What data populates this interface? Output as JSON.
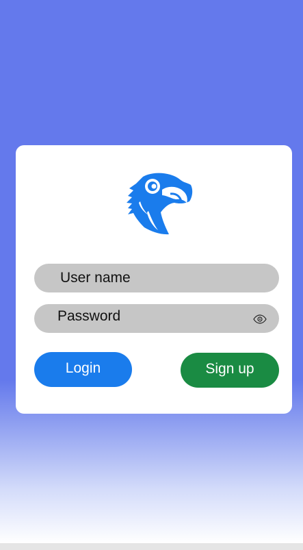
{
  "login_form": {
    "username_placeholder": "User name",
    "password_placeholder": "Password",
    "login_label": "Login",
    "signup_label": "Sign up"
  },
  "icons": {
    "logo": "eagle-head-icon",
    "password_toggle": "eye-icon"
  },
  "colors": {
    "background": "#6479ec",
    "card": "#ffffff",
    "input": "#c6c6c6",
    "login_button": "#1a7cec",
    "signup_button": "#1a8b43",
    "logo": "#1a7cec"
  }
}
